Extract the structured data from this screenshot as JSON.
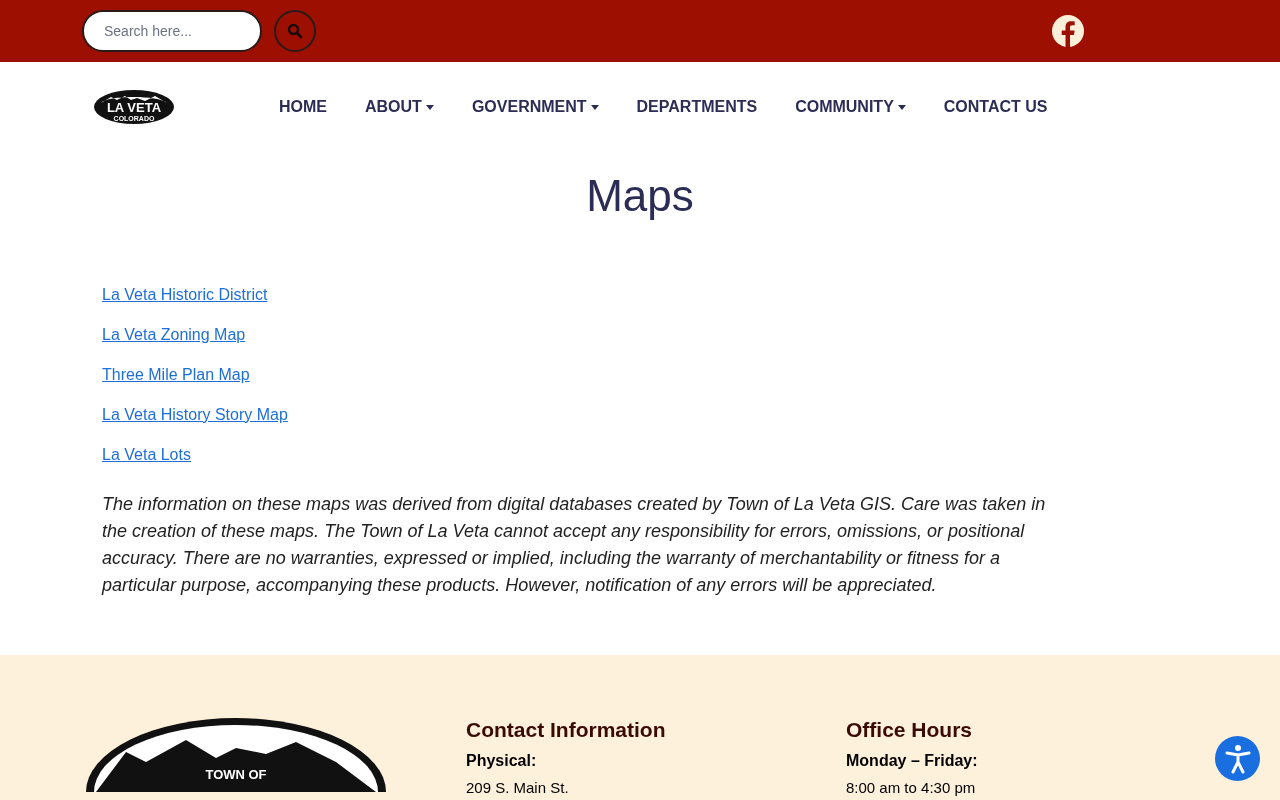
{
  "top_bar": {
    "search": {
      "placeholder": "Search here..."
    }
  },
  "logo": {
    "main_text": "LA VETA",
    "sub_text": "COLORADO"
  },
  "nav": [
    {
      "label": "HOME",
      "dropdown": false
    },
    {
      "label": "ABOUT",
      "dropdown": true
    },
    {
      "label": "GOVERNMENT",
      "dropdown": true
    },
    {
      "label": "DEPARTMENTS",
      "dropdown": false
    },
    {
      "label": "COMMUNITY",
      "dropdown": true
    },
    {
      "label": "CONTACT US",
      "dropdown": false
    }
  ],
  "page_title": "Maps",
  "links": [
    "La Veta Historic District",
    "La Veta Zoning Map",
    "Three Mile Plan Map",
    "La Veta History Story Map",
    "La Veta Lots"
  ],
  "disclaimer": "The information on these maps was derived from digital databases created by Town of La Veta GIS. Care was taken in the creation of these maps. The Town of La Veta cannot accept any responsibility for errors, omissions, or positional accuracy. There are no warranties, expressed or implied, including the warranty of merchantability or fitness for a particular purpose, accompanying these products. However, notification of any errors will be appreciated.",
  "footer": {
    "logo_text": "TOWN OF",
    "columns": [
      {
        "heading": "Contact Information",
        "label": "Physical:",
        "line": "209 S. Main St."
      },
      {
        "heading": "Office Hours",
        "label": "Monday – Friday:",
        "line": "8:00 am to 4:30 pm"
      }
    ]
  }
}
